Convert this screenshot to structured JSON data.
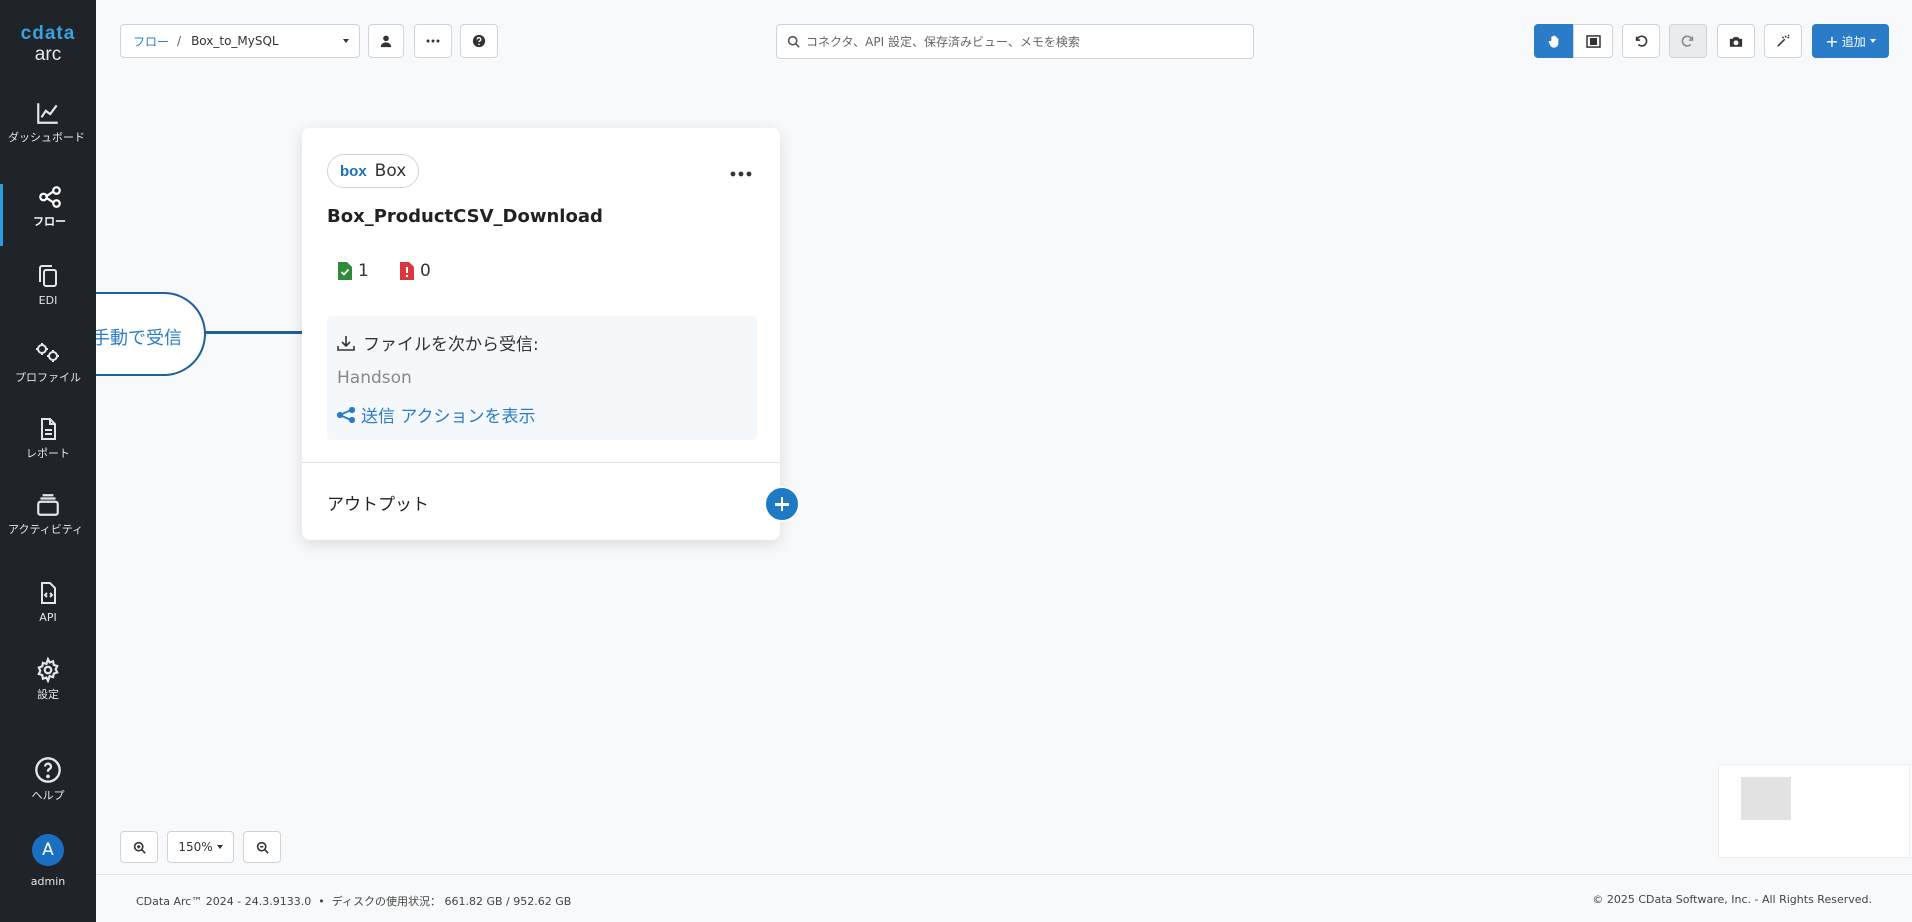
{
  "app": {
    "logo_top": "cdata",
    "logo_bottom": "arc"
  },
  "sidebar": {
    "items": [
      {
        "label": "ダッシュボード",
        "icon": "chart-line-icon"
      },
      {
        "label": "フロー",
        "icon": "flow-icon",
        "active": true
      },
      {
        "label": "EDI",
        "icon": "copy-icon"
      },
      {
        "label": "プロファイル",
        "icon": "gears-icon"
      },
      {
        "label": "レポート",
        "icon": "document-icon"
      },
      {
        "label": "アクティビティ",
        "icon": "layers-icon"
      },
      {
        "label": "API",
        "icon": "code-file-icon"
      },
      {
        "label": "設定",
        "icon": "gear-icon"
      }
    ],
    "help_label": "ヘルプ",
    "user_initial": "A",
    "user_name": "admin"
  },
  "toolbar": {
    "breadcrumb": "フロー",
    "breadcrumb_sep": "/",
    "flow_name": "Box_to_MySQL",
    "search_placeholder": "コネクタ、API 設定、保存済みビュー、メモを検索",
    "add_label": "追加"
  },
  "canvas": {
    "trigger_label": "手動で受信",
    "card": {
      "connector_logo": "box",
      "connector_name": "Box",
      "title": "Box_ProductCSV_Download",
      "success_count": "1",
      "error_count": "0",
      "receive_label": "ファイルを次から受信:",
      "receive_value": "Handson",
      "send_link": "送信 アクションを表示",
      "output_label": "アウトプット"
    },
    "zoom_level": "150%"
  },
  "footer": {
    "version": "CData Arc™ 2024 - 24.3.9133.0",
    "disk_label": "ディスクの使用状況：",
    "disk_usage": "661.82 GB / 952.62 GB",
    "copyright": "© 2025 CData Software, Inc. - All Rights Reserved."
  },
  "colors": {
    "accent": "#2b7cc8",
    "sidebar_bg": "#1f2429",
    "success": "#2e8b3a",
    "error": "#d9363e"
  }
}
